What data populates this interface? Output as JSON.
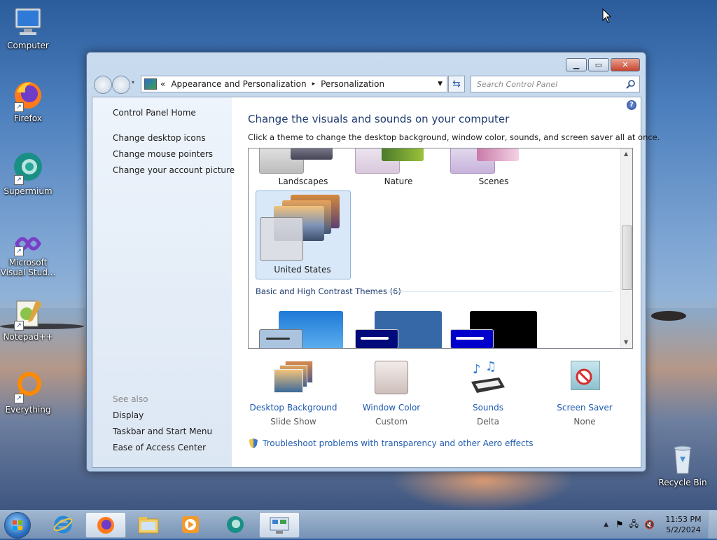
{
  "desktop": {
    "icons": [
      {
        "label": "Computer"
      },
      {
        "label": "Firefox"
      },
      {
        "label": "Supermium"
      },
      {
        "label": "Microsoft Visual Stud..."
      },
      {
        "label": "Notepad++"
      },
      {
        "label": "Everything"
      },
      {
        "label": "Recycle Bin"
      }
    ]
  },
  "window": {
    "address": {
      "sep": "«",
      "crumb1": "Appearance and Personalization",
      "arrow": "▸",
      "crumb2": "Personalization"
    },
    "search_placeholder": "Search Control Panel",
    "left_links": [
      "Control Panel Home",
      "Change desktop icons",
      "Change mouse pointers",
      "Change your account picture"
    ],
    "see_also_label": "See also",
    "see_also_links": [
      "Display",
      "Taskbar and Start Menu",
      "Ease of Access Center"
    ],
    "heading": "Change the visuals and sounds on your computer",
    "subheading": "Click a theme to change the desktop background, window color, sounds, and screen saver all at once.",
    "themes": [
      "Landscapes",
      "Nature",
      "Scenes",
      "United States"
    ],
    "selected_theme": "United States",
    "group_label": "Basic and High Contrast Themes (6)",
    "bottom_items": [
      {
        "label": "Desktop Background",
        "value": "Slide Show",
        "icon": "desktop-background-icon"
      },
      {
        "label": "Window Color",
        "value": "Custom",
        "icon": "window-color-icon"
      },
      {
        "label": "Sounds",
        "value": "Delta",
        "icon": "sounds-icon"
      },
      {
        "label": "Screen Saver",
        "value": "None",
        "icon": "screen-saver-icon"
      }
    ],
    "troubleshoot": "Troubleshoot problems with transparency and other Aero effects"
  },
  "taskbar": {
    "time": "11:53 PM",
    "date": "5/2/2024",
    "pinned": [
      "internet-explorer",
      "firefox",
      "file-explorer",
      "media-player",
      "supermium",
      "control-panel"
    ]
  },
  "colors": {
    "accent_link": "#1f5bb0",
    "heading": "#1e3a6e"
  }
}
